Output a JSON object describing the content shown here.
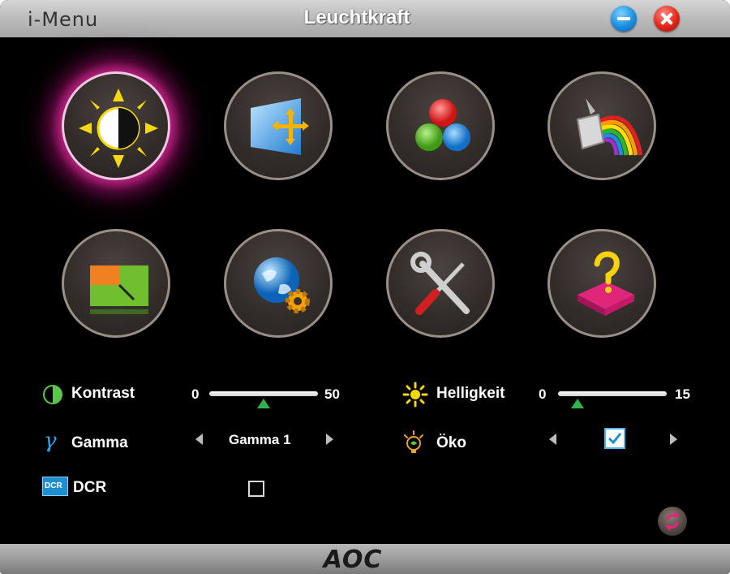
{
  "window": {
    "app_name": "i-Menu",
    "title": "Leuchtkraft",
    "minimize_icon": "minimize-icon",
    "close_icon": "close-icon"
  },
  "menu_icons": [
    {
      "name": "luminance-icon",
      "selected": true
    },
    {
      "name": "image-setup-icon",
      "selected": false
    },
    {
      "name": "color-temperature-icon",
      "selected": false
    },
    {
      "name": "color-boost-icon",
      "selected": false
    },
    {
      "name": "picture-boost-icon",
      "selected": false
    },
    {
      "name": "osd-setup-icon",
      "selected": false
    },
    {
      "name": "extra-icon",
      "selected": false
    },
    {
      "name": "exit-icon",
      "selected": false
    }
  ],
  "settings": {
    "contrast": {
      "label": "Kontrast",
      "min": "0",
      "max": "50",
      "value_fraction": 0.5
    },
    "brightness": {
      "label": "Helligkeit",
      "min": "0",
      "max": "15",
      "value_fraction": 0.18
    },
    "gamma": {
      "label": "Gamma",
      "value": "Gamma 1"
    },
    "eco": {
      "label": "Öko",
      "checked": true
    },
    "dcr": {
      "label": "DCR",
      "checked": false,
      "icon_text": "DCR"
    }
  },
  "footer": {
    "logo": "AOC"
  },
  "colors": {
    "accent_selected": "#b1207a",
    "slider_thumb": "#2fb34a",
    "checkbox_border": "#4fb7e8"
  }
}
